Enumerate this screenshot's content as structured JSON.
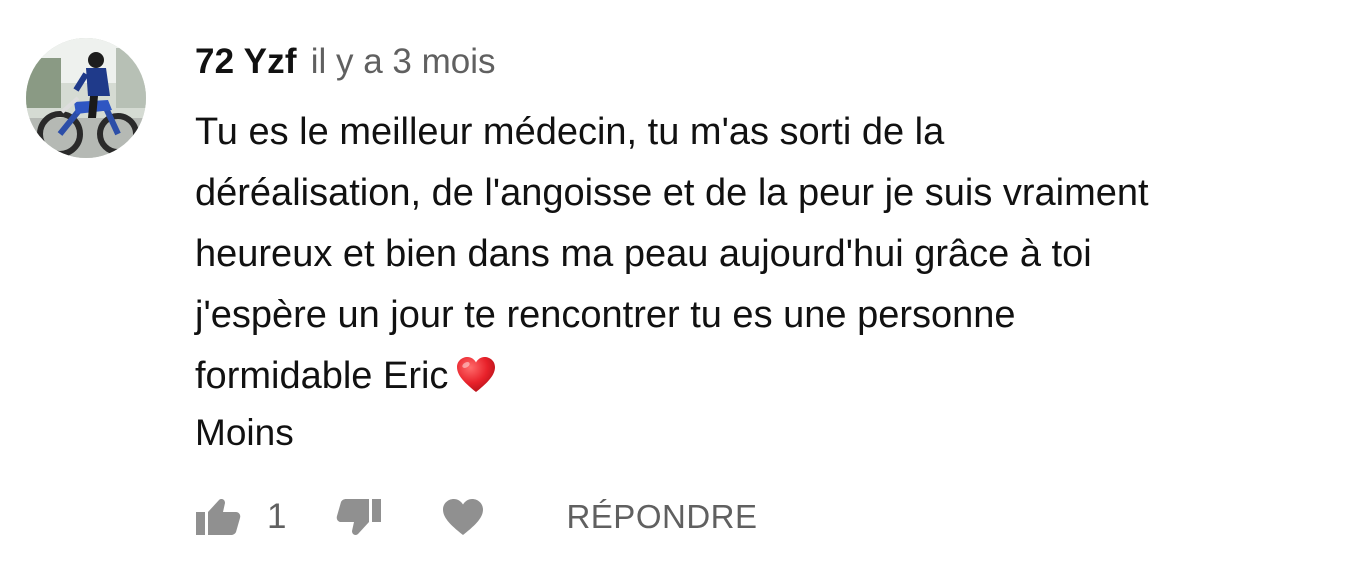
{
  "comment": {
    "author": "72 Yzf",
    "timestamp": "il y a 3 mois",
    "lines": [
      "Tu es le meilleur médecin, tu m'as sorti de la",
      "déréalisation, de l'angoisse et de la peur je suis vraiment",
      "heureux et bien dans ma peau aujourd'hui grâce à toi",
      "j'espère un jour te rencontrer tu es une personne",
      "formidable Eric"
    ],
    "emoji": "heart-emoji",
    "show_less_label": "Moins"
  },
  "actions": {
    "like_icon": "thumbs-up-icon",
    "like_count": "1",
    "dislike_icon": "thumbs-down-icon",
    "heart_icon": "heart-icon",
    "reply_label": "RÉPONDRE"
  },
  "colors": {
    "text": "#111111",
    "secondary": "#606060",
    "icon": "#909090",
    "heart": "#e8212a"
  }
}
